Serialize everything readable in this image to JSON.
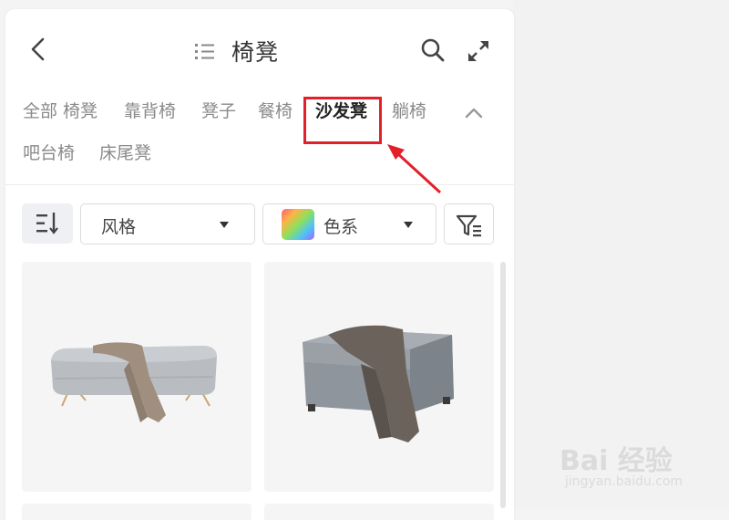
{
  "header": {
    "title": "椅凳",
    "icons": {
      "back": "chevron-left-icon",
      "list": "list-icon",
      "search": "search-icon",
      "expand": "expand-icon"
    }
  },
  "categories": [
    {
      "label": "全部 椅凳",
      "active": false
    },
    {
      "label": "靠背椅",
      "active": false
    },
    {
      "label": "凳子",
      "active": false
    },
    {
      "label": "餐椅",
      "active": false
    },
    {
      "label": "沙发凳",
      "active": true
    },
    {
      "label": "躺椅",
      "active": false
    },
    {
      "label": "吧台椅",
      "active": false
    },
    {
      "label": "床尾凳",
      "active": false
    }
  ],
  "filters": {
    "sort_icon": "sort-icon",
    "style_label": "风格",
    "color_label": "色系",
    "filter_icon": "filter-icon"
  },
  "products": [
    {
      "name": "bench-with-throw",
      "color": "#b9bcc0"
    },
    {
      "name": "ottoman-with-throw",
      "color": "#8f959c"
    }
  ],
  "watermark": {
    "logo": "Bai 经验",
    "url": "jingyan.baidu.com"
  },
  "colors": {
    "highlight": "#e3202a",
    "active_text": "#222222",
    "inactive_text": "#8a8a8a"
  }
}
